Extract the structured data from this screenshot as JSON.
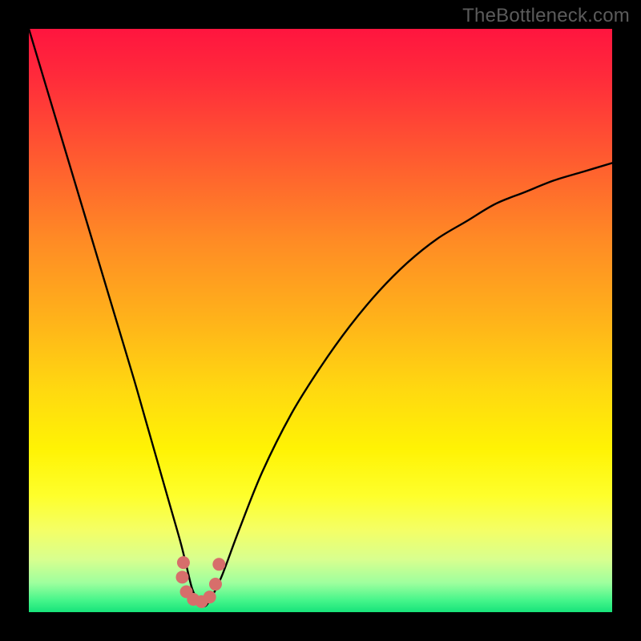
{
  "watermark": "TheBottleneck.com",
  "colors": {
    "frame": "#000000",
    "curve": "#000000",
    "marker": "#d76e6b"
  },
  "chart_data": {
    "type": "line",
    "title": "",
    "xlabel": "",
    "ylabel": "",
    "xlim": [
      0,
      100
    ],
    "ylim": [
      0,
      100
    ],
    "grid": false,
    "legend": false,
    "note": "Axes are unlabeled; x/y are normalized 0–100 across the plot area (left→right, bottom→top). Values are visual estimates.",
    "series": [
      {
        "name": "curve",
        "x": [
          0,
          3,
          6,
          9,
          12,
          15,
          18,
          20,
          22,
          24,
          26,
          27,
          28,
          29,
          30,
          31,
          33,
          36,
          40,
          45,
          50,
          55,
          60,
          65,
          70,
          75,
          80,
          85,
          90,
          95,
          100
        ],
        "y": [
          100,
          90,
          80,
          70,
          60,
          50,
          40,
          33,
          26,
          19,
          12,
          8,
          4,
          2,
          1,
          2,
          6,
          14,
          24,
          34,
          42,
          49,
          55,
          60,
          64,
          67,
          70,
          72,
          74,
          75.5,
          77
        ]
      }
    ],
    "minimum_region": {
      "x_range": [
        27,
        32
      ],
      "y_approx": 1
    },
    "marker_points": {
      "note": "Dotted 'U' shaped cluster near curve minimum; normalized 0–100 coords.",
      "points": [
        {
          "x": 26.5,
          "y": 8.5
        },
        {
          "x": 26.3,
          "y": 6.0
        },
        {
          "x": 27.0,
          "y": 3.5
        },
        {
          "x": 28.2,
          "y": 2.2
        },
        {
          "x": 29.6,
          "y": 1.8
        },
        {
          "x": 31.0,
          "y": 2.6
        },
        {
          "x": 32.0,
          "y": 4.8
        },
        {
          "x": 32.6,
          "y": 8.2
        }
      ]
    }
  }
}
